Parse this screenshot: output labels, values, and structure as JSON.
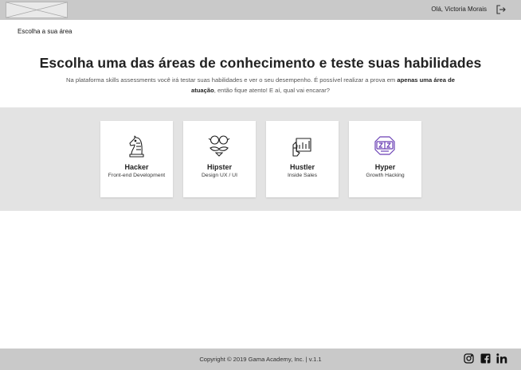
{
  "header": {
    "greeting": "Olá, Victoria Morais",
    "logo_icon": "placeholder-image-icon",
    "logout_icon": "logout-icon"
  },
  "breadcrumb": "Escolha a sua área",
  "headline": "Escolha uma das áreas de conhecimento e teste suas habilidades",
  "subtext": {
    "part1": "Na plataforma skills assessments você irá testar suas habilidades e ver o seu desempenho. É possível realizar a prova em ",
    "bold": "apenas uma área de atuação",
    "part2": ", então fique atento! E aí, qual vai encarar?"
  },
  "areas": [
    {
      "title": "Hacker",
      "subtitle": "Front-end Development",
      "icon": "chess-knight-icon"
    },
    {
      "title": "Hipster",
      "subtitle": "Design UX / UI",
      "icon": "hipster-glasses-icon"
    },
    {
      "title": "Hustler",
      "subtitle": "Inside Sales",
      "icon": "chart-hand-icon"
    },
    {
      "title": "Hyper",
      "subtitle": "Growth Hacking",
      "icon": "vr-headset-icon"
    }
  ],
  "colors": {
    "bars": "#c9c9c9",
    "band": "#e3e3e3",
    "hyper_icon": "#6a3fb5"
  },
  "footer": {
    "copyright": "Copyright © 2019  Gama Academy, Inc. | v.1.1",
    "social": [
      "instagram-icon",
      "facebook-icon",
      "linkedin-icon"
    ]
  }
}
